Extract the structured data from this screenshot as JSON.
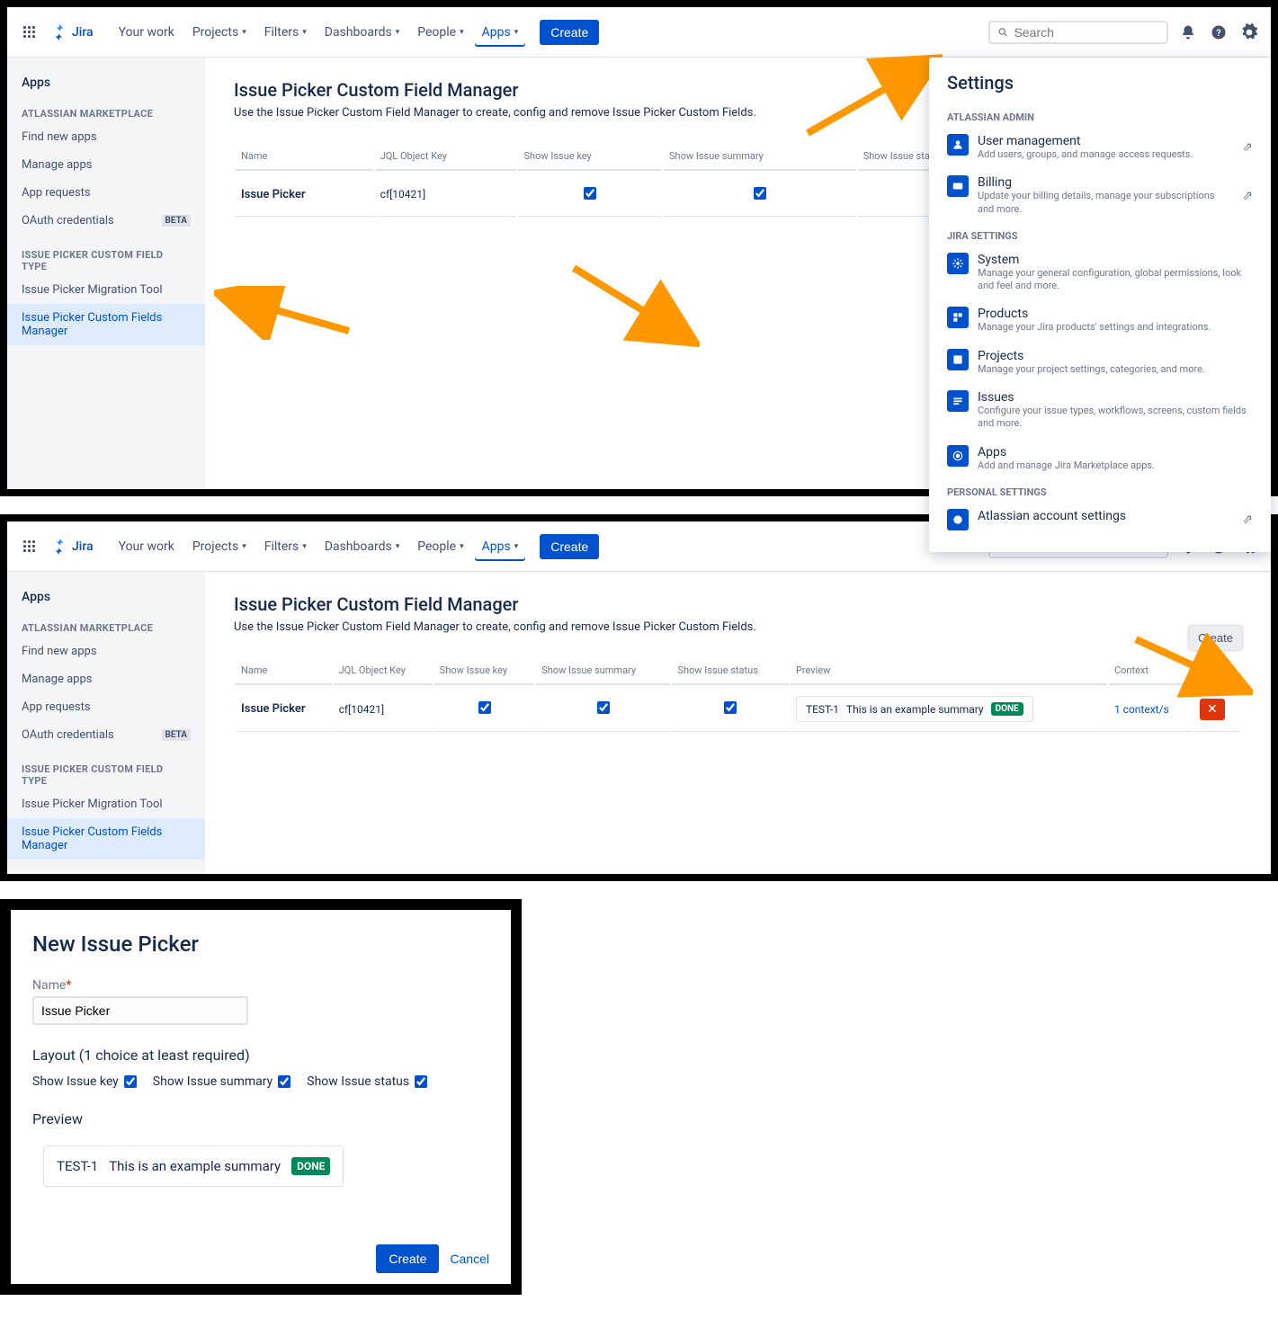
{
  "nav": {
    "product": "Jira",
    "items": [
      "Your work",
      "Projects",
      "Filters",
      "Dashboards",
      "People",
      "Apps"
    ],
    "active_index": 5,
    "create": "Create",
    "search_placeholder": "Search"
  },
  "sidebar": {
    "title": "Apps",
    "group1_label": "ATLASSIAN MARKETPLACE",
    "group1_items": [
      "Find new apps",
      "Manage apps",
      "App requests",
      "OAuth credentials"
    ],
    "beta": "BETA",
    "group2_label": "ISSUE PICKER CUSTOM FIELD TYPE",
    "group2_items": [
      "Issue Picker Migration Tool",
      "Issue Picker Custom Fields Manager"
    ]
  },
  "page": {
    "title": "Issue Picker Custom Field Manager",
    "subtitle": "Use the Issue Picker Custom Field Manager to create, config and remove Issue Picker Custom Fields.",
    "create_label": "Create"
  },
  "table": {
    "cols": [
      "Name",
      "JQL Object Key",
      "Show Issue key",
      "Show Issue summary",
      "Show Issue status",
      "Preview",
      "Context"
    ],
    "row": {
      "name": "Issue Picker",
      "key": "cf[10421]",
      "preview_key": "TEST-1",
      "preview_summary_short": "This is an",
      "preview_summary": "This is an example summary",
      "status": "DONE",
      "context": "1 context/s"
    }
  },
  "settings": {
    "title": "Settings",
    "group1": "ATLASSIAN ADMIN",
    "admin_items": [
      {
        "title": "User management",
        "desc": "Add users, groups, and manage access requests.",
        "ext": true
      },
      {
        "title": "Billing",
        "desc": "Update your billing details, manage your subscriptions and more.",
        "ext": true
      }
    ],
    "group2": "JIRA SETTINGS",
    "jira_items": [
      {
        "title": "System",
        "desc": "Manage your general configuration, global permissions, look and feel and more."
      },
      {
        "title": "Products",
        "desc": "Manage your Jira products' settings and integrations."
      },
      {
        "title": "Projects",
        "desc": "Manage your project settings, categories, and more."
      },
      {
        "title": "Issues",
        "desc": "Configure your issue types, workflows, screens, custom fields and more."
      },
      {
        "title": "Apps",
        "desc": "Add and manage Jira Marketplace apps."
      }
    ],
    "group3": "PERSONAL SETTINGS",
    "personal_items": [
      {
        "title": "Atlassian account settings",
        "ext": true
      }
    ]
  },
  "dialog": {
    "title": "New Issue Picker",
    "name_label": "Name",
    "name_value": "Issue Picker",
    "layout_label": "Layout (1 choice at least required)",
    "opt_key": "Show Issue key",
    "opt_summary": "Show Issue summary",
    "opt_status": "Show Issue status",
    "preview_label": "Preview",
    "preview_key": "TEST-1",
    "preview_summary": "This is an example summary",
    "preview_status": "DONE",
    "create": "Create",
    "cancel": "Cancel"
  }
}
